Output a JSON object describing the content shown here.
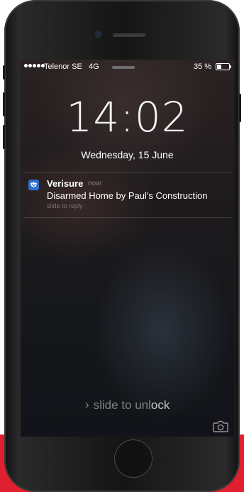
{
  "status_bar": {
    "carrier": "Telenor SE",
    "network": "4G",
    "battery_percent_label": "35 %",
    "battery_level": 0.35
  },
  "lock_screen": {
    "time": "14:02",
    "date": "Wednesday, 15 June",
    "unlock_prefix": "slide to unl",
    "unlock_highlight": "ock",
    "chevron": "›"
  },
  "notification": {
    "app_name": "Verisure",
    "time": "now",
    "message": "Disarmed Home by Paul's Construction",
    "action_hint": "slide to reply",
    "icon": "verisure-app-icon"
  },
  "icons": {
    "camera": "camera-icon",
    "accent_color": "#2f6fd1",
    "background_strip_color": "#e0202e"
  }
}
